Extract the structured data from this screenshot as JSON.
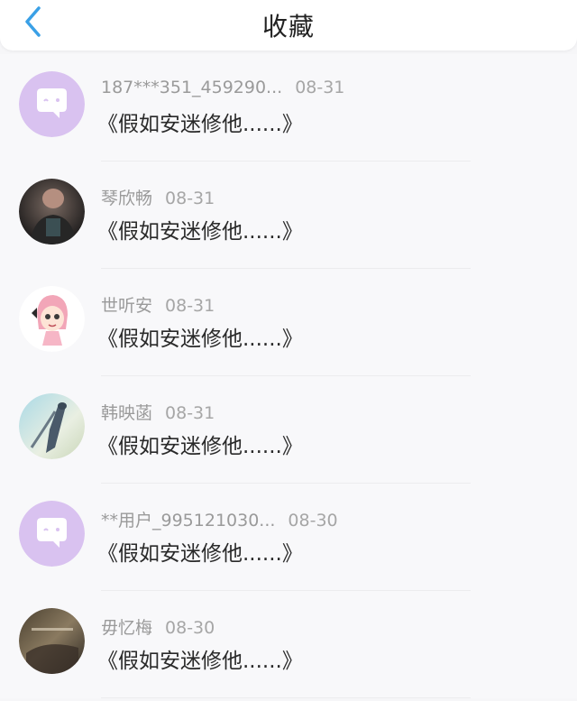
{
  "header": {
    "title": "收藏",
    "back_icon": "chevron-left-icon",
    "accent_color": "#3aa0e6"
  },
  "items": [
    {
      "name": "187***351_459290...",
      "time": "08-31",
      "content": "《假如安迷修他......》",
      "avatar": "default-chat-avatar"
    },
    {
      "name": "琴欣畅",
      "time": "08-31",
      "content": "《假如安迷修他......》",
      "avatar": "photo-avatar-person"
    },
    {
      "name": "世听安",
      "time": "08-31",
      "content": "《假如安迷修他......》",
      "avatar": "anime-girl-avatar"
    },
    {
      "name": "韩映菡",
      "time": "08-31",
      "content": "《假如安迷修他......》",
      "avatar": "anime-scene-avatar"
    },
    {
      "name": "**用户_995121030...",
      "time": "08-30",
      "content": "《假如安迷修他......》",
      "avatar": "default-chat-avatar"
    },
    {
      "name": "毋忆梅",
      "time": "08-30",
      "content": "《假如安迷修他......》",
      "avatar": "dark-photo-avatar"
    }
  ],
  "colors": {
    "default_avatar_bg": "#d9c2f0",
    "meta_text": "#9a9a9a"
  }
}
